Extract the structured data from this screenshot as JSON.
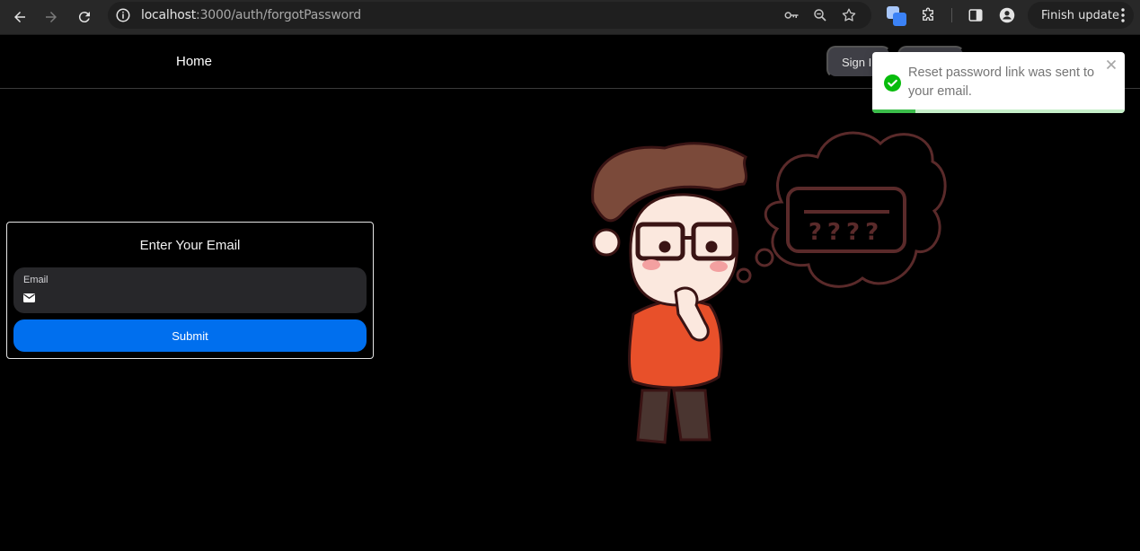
{
  "browser": {
    "url_host": "localhost",
    "url_path": ":3000/auth/forgotPassword",
    "update_button_label": "Finish update",
    "icons": [
      "back-arrow-icon",
      "forward-arrow-icon",
      "reload-icon",
      "site-info-icon",
      "password-key-icon",
      "zoom-icon",
      "bookmark-star-icon",
      "extension-app-icon",
      "puzzle-extensions-icon",
      "side-panel-icon",
      "profile-icon",
      "more-vert-icon"
    ]
  },
  "nav": {
    "home_label": "Home",
    "sign_in_label": "Sign In",
    "sign_up_label": ""
  },
  "form": {
    "title": "Enter Your Email",
    "email_label": "Email",
    "email_value": "",
    "email_placeholder": "",
    "submit_label": "Submit"
  },
  "toast": {
    "message": "Reset password link was sent to your email.",
    "type": "success",
    "progress_remaining": 0.17,
    "colors": {
      "success": "#07bc0c",
      "progress": "#3bbd4a"
    }
  },
  "illustration": {
    "subject": "confused person with glasses thinking about forgotten password",
    "thought_text": "????"
  },
  "colors": {
    "accent": "#006fee",
    "background": "#000000"
  }
}
